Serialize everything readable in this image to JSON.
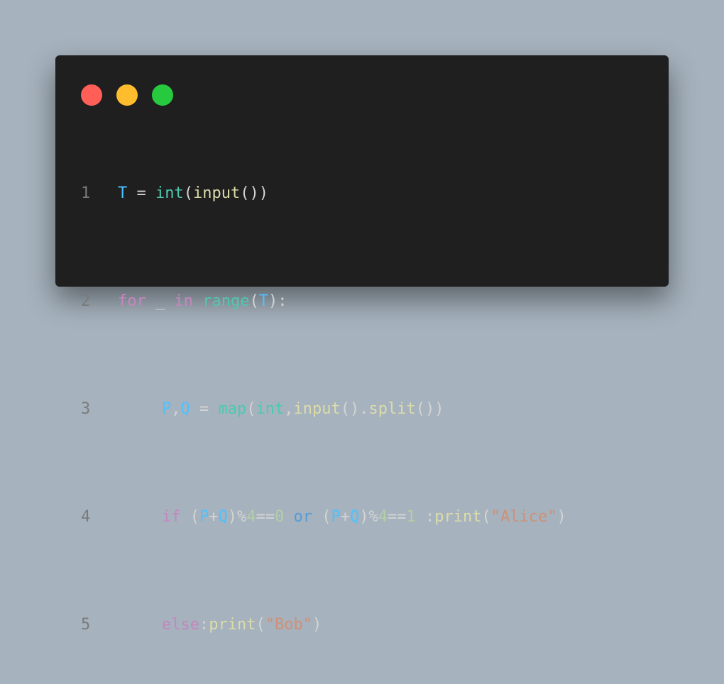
{
  "colors": {
    "background": "#a6b2bd",
    "window": "#1f1f1f",
    "close": "#ff5f56",
    "minimize": "#ffbd2e",
    "maximize": "#27c93f"
  },
  "window_controls": [
    "close-dot",
    "minimize-dot",
    "maximize-dot"
  ],
  "code": {
    "language": "python",
    "lines": [
      {
        "number": "1",
        "tokens": {
          "t1": "T",
          "t2": " = ",
          "t3": "int",
          "t4": "(",
          "t5": "input",
          "t6": "())"
        }
      },
      {
        "number": "2",
        "tokens": {
          "t1": "for",
          "t2": " _ ",
          "t3": "in",
          "t4": " ",
          "t5": "range",
          "t6": "(",
          "t7": "T",
          "t8": "):"
        }
      },
      {
        "number": "3",
        "tokens": {
          "t1": "P",
          "t2": ",",
          "t3": "Q",
          "t4": " = ",
          "t5": "map",
          "t6": "(",
          "t7": "int",
          "t8": ",",
          "t9": "input",
          "t10": "().",
          "t11": "split",
          "t12": "())"
        }
      },
      {
        "number": "4",
        "tokens": {
          "t1": "if",
          "t2": " (",
          "t3": "P",
          "t4": "+",
          "t5": "Q",
          "t6": ")%",
          "t7": "4",
          "t8": "==",
          "t9": "0",
          "t10": " ",
          "t11": "or",
          "t12": " (",
          "t13": "P",
          "t14": "+",
          "t15": "Q",
          "t16": ")%",
          "t17": "4",
          "t18": "==",
          "t19": "1",
          "t20": " :",
          "t21": "print",
          "t22": "(",
          "t23": "\"Alice\"",
          "t24": ")"
        }
      },
      {
        "number": "5",
        "tokens": {
          "t1": "else",
          "t2": ":",
          "t3": "print",
          "t4": "(",
          "t5": "\"Bob\"",
          "t6": ")"
        }
      }
    ]
  }
}
